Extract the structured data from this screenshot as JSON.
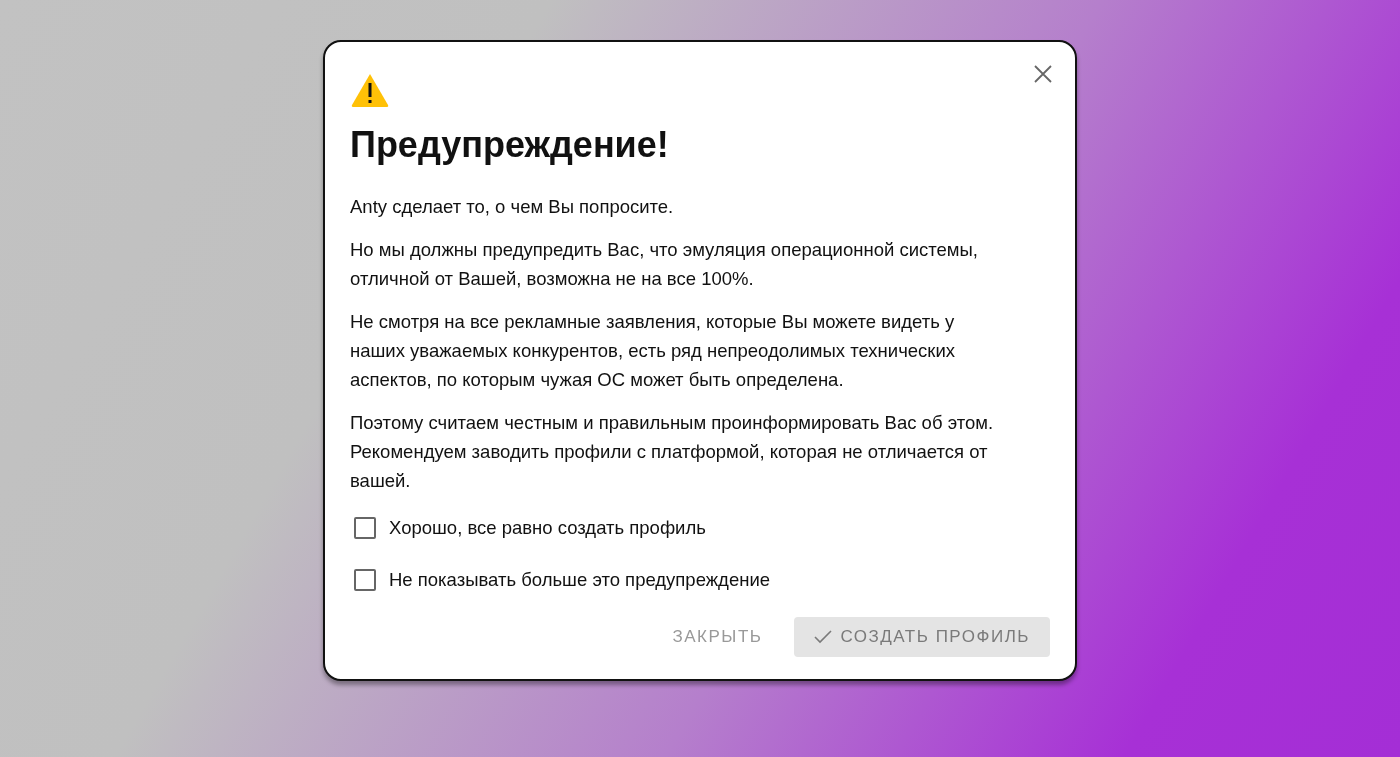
{
  "dialog": {
    "title": "Предупреждение!",
    "paragraphs": [
      "Anty сделает то, о чем Вы попросите.",
      "Но мы должны предупредить Вас, что эмуляция операционной системы, отличной от Вашей, возможна не на все 100%.",
      "Не смотря на все рекламные заявления, которые Вы можете видеть у наших уважаемых конкурентов, есть ряд непреодолимых технических аспектов, по которым чужая ОС может быть определена.",
      "Поэтому считаем честным и правильным проинформировать Вас об этом. Рекомендуем заводить профили с платформой, которая не отличается от вашей."
    ],
    "checkboxes": [
      {
        "label": "Хорошо, все равно создать профиль",
        "checked": false
      },
      {
        "label": "Не показывать больше это предупреждение",
        "checked": false
      }
    ],
    "buttons": [
      {
        "label": "ЗАКРЫТЬ",
        "kind": "text",
        "disabled": false
      },
      {
        "label": "СОЗДАТЬ ПРОФИЛЬ",
        "kind": "primary",
        "disabled": true
      }
    ]
  }
}
